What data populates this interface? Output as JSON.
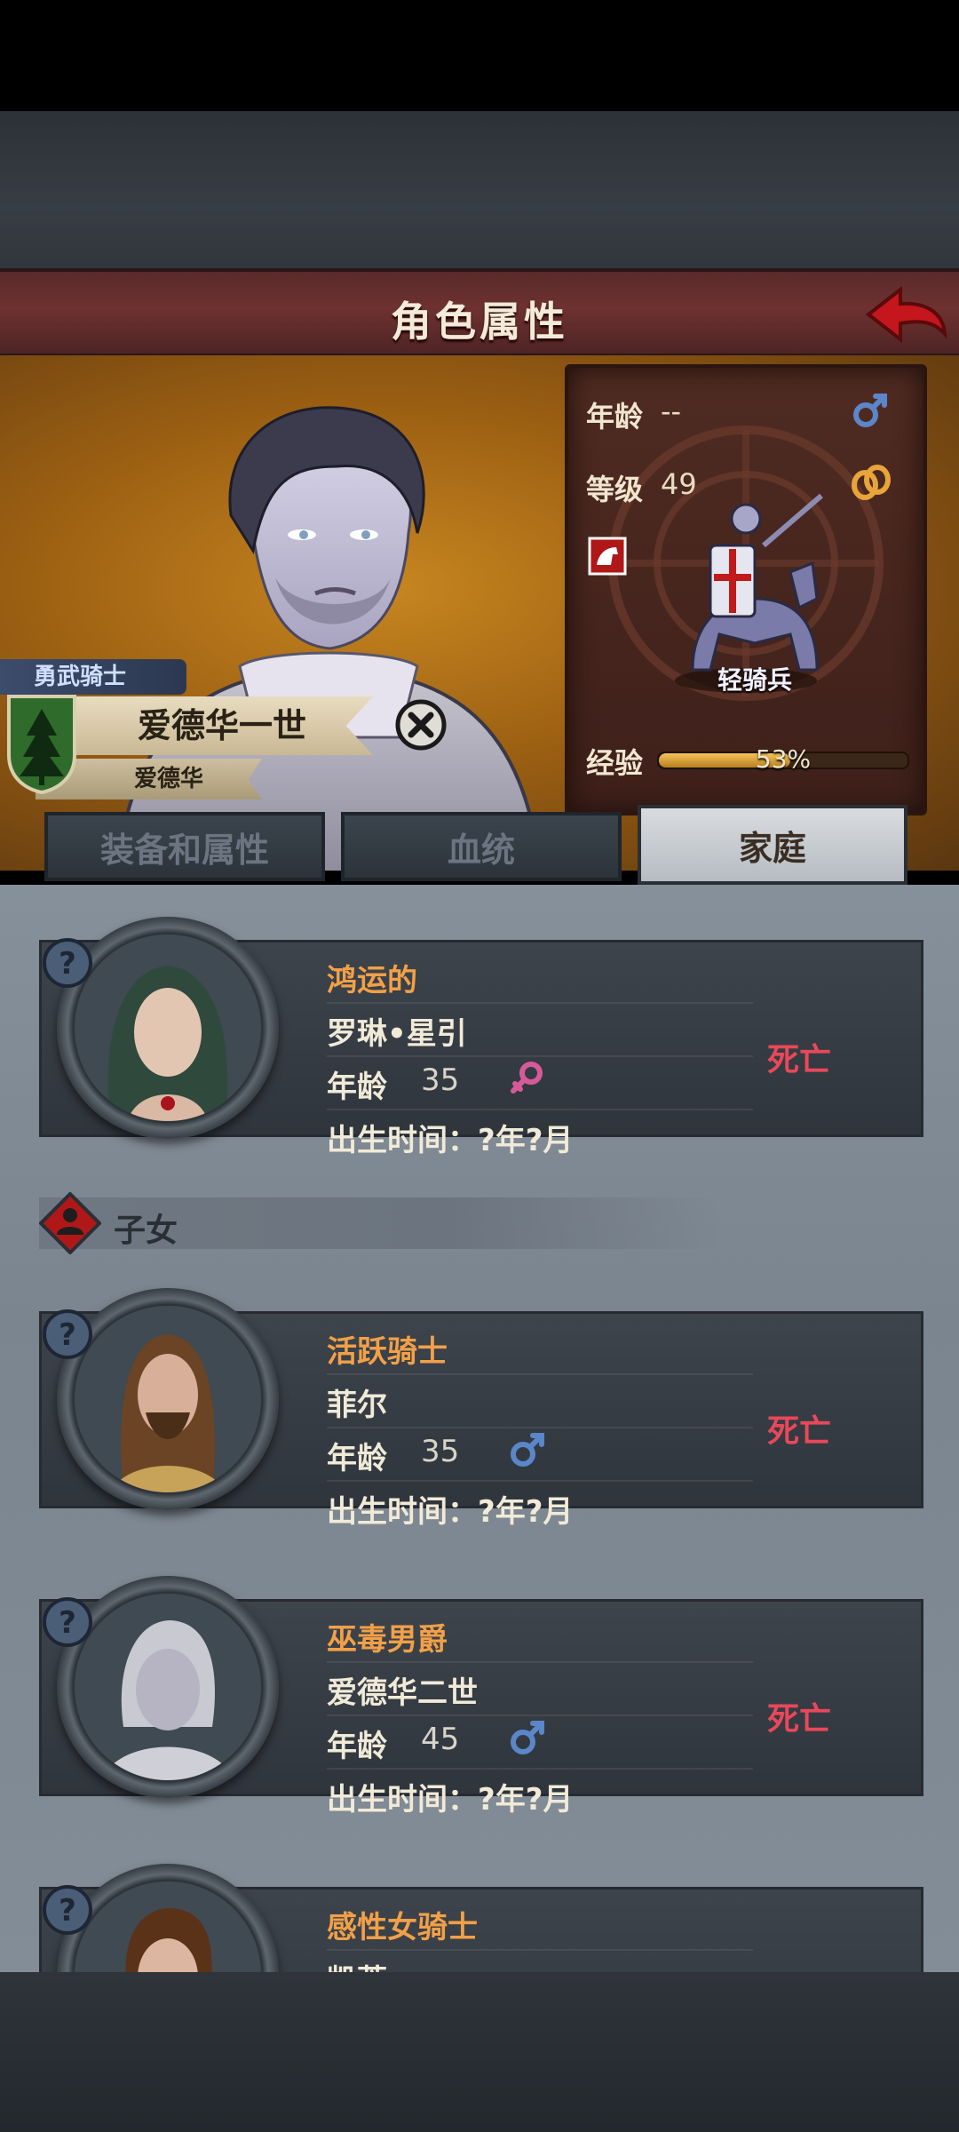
{
  "header": {
    "title": "角色属性"
  },
  "hero": {
    "class_tag": "勇武骑士",
    "name": "爱德华一世",
    "house": "爱德华",
    "stats": {
      "age_label": "年龄",
      "age_value": "--",
      "level_label": "等级",
      "level_value": "49",
      "unit_name": "轻骑兵",
      "xp_label": "经验",
      "xp_text": "53%",
      "xp_fraction": 0.53
    }
  },
  "tabs": [
    {
      "label": "装备和属性",
      "active": false
    },
    {
      "label": "血统",
      "active": false
    },
    {
      "label": "家庭",
      "active": true
    }
  ],
  "spouse": {
    "title": "鸿运的",
    "name": "罗琳•星引",
    "age_label": "年龄",
    "age": "35",
    "gender": "female",
    "birth": "出生时间：?年?月",
    "status": "死亡"
  },
  "children_section": {
    "label": "子女"
  },
  "children": [
    {
      "title": "活跃骑士",
      "name": "菲尔",
      "age_label": "年龄",
      "age": "35",
      "gender": "male",
      "birth": "出生时间：?年?月",
      "status": "死亡"
    },
    {
      "title": "巫毒男爵",
      "name": "爱德华二世",
      "age_label": "年龄",
      "age": "45",
      "gender": "male",
      "birth": "出生时间：?年?月",
      "status": "死亡"
    },
    {
      "title": "感性女骑士",
      "name": "凯蒂"
    }
  ],
  "colors": {
    "title_bar": "#6e3131",
    "accent_orange": "#f2a048",
    "status_red": "#e9485a",
    "male_blue": "#5b86c9",
    "female_pink": "#d65a9a"
  }
}
